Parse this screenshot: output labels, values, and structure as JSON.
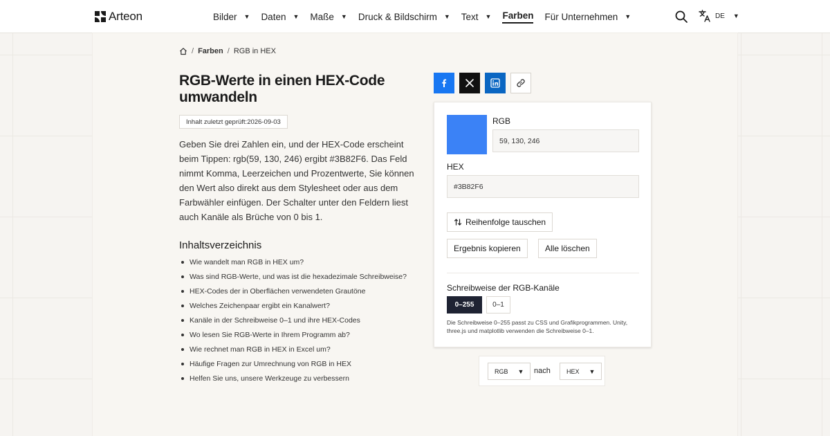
{
  "brand": {
    "name": "Arteon"
  },
  "nav": [
    {
      "label": "Bilder",
      "active": false
    },
    {
      "label": "Daten",
      "active": false
    },
    {
      "label": "Maße",
      "active": false
    },
    {
      "label": "Druck & Bildschirm",
      "active": false
    },
    {
      "label": "Text",
      "active": false
    },
    {
      "label": "Farben",
      "active": true
    },
    {
      "label": "Für Unternehmen",
      "active": false
    }
  ],
  "language": {
    "code": "DE",
    "icon": "translate-icon"
  },
  "breadcrumb": {
    "home_icon": "home-icon",
    "section": "Farben",
    "current": "RGB in HEX"
  },
  "article": {
    "title": "RGB-Werte in einen HEX-Code umwandeln",
    "checked": "Inhalt zuletzt geprüft:2026-09-03",
    "intro": "Geben Sie drei Zahlen ein, und der HEX-Code erscheint beim Tippen: rgb(59, 130, 246) ergibt #3B82F6. Das Feld nimmt Komma, Leerzeichen und Prozentwerte, Sie können den Wert also direkt aus dem Stylesheet oder aus dem Farbwähler einfügen. Der Schalter unter den Feldern liest auch Kanäle als Brüche von 0 bis 1."
  },
  "toc": {
    "title": "Inhaltsverzeichnis",
    "items": [
      "Wie wandelt man RGB in HEX um?",
      "Was sind RGB-Werte, und was ist die hexadezimale Schreibweise?",
      "HEX-Codes der in Oberflächen verwendeten Grautöne",
      "Welches Zeichenpaar ergibt ein Kanalwert?",
      "Kanäle in der Schreibweise 0–1 und ihre HEX-Codes",
      "Wo lesen Sie RGB-Werte in Ihrem Programm ab?",
      "Wie rechnet man RGB in HEX in Excel um?",
      "Häufige Fragen zur Umrechnung von RGB in HEX",
      "Helfen Sie uns, unsere Werkzeuge zu verbessern"
    ]
  },
  "share": {
    "facebook_icon": "facebook-icon",
    "x_icon": "x-icon",
    "linkedin_icon": "linkedin-icon",
    "link_icon": "link-icon"
  },
  "converter": {
    "swatch_color": "#3b82f6",
    "rgb_label": "RGB",
    "rgb_value": "59, 130, 246",
    "hex_label": "HEX",
    "hex_value": "#3B82F6",
    "swap_label": "Reihenfolge tauschen",
    "copy_label": "Ergebnis kopieren",
    "clear_label": "Alle löschen",
    "notation_label": "Schreibweise der RGB-Kanäle",
    "notation_options": [
      "0–255",
      "0–1"
    ],
    "notation_selected": "0–255",
    "notation_help": "Die Schreibweise 0–255 passt zu CSS und Grafikprogrammen. Unity, three.js und matplotlib verwenden die Schreibweise 0–1."
  },
  "mode": {
    "from": "RGB",
    "separator": "nach",
    "to": "HEX"
  }
}
